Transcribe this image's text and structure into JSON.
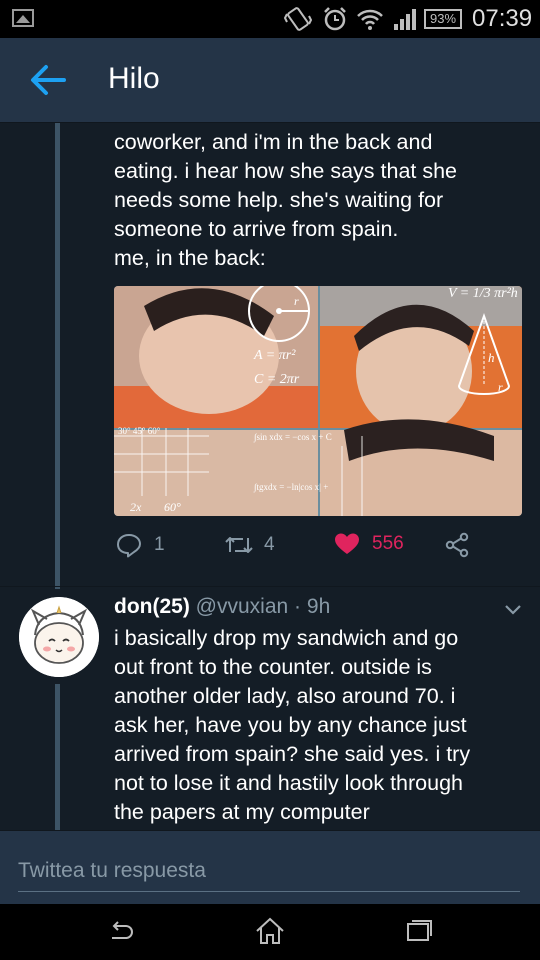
{
  "status_bar": {
    "battery": "93%",
    "time": "07:39"
  },
  "header": {
    "title": "Hilo"
  },
  "tweet1": {
    "text_lines": [
      "coworker, and i'm in the back and",
      "eating. i hear how she says that she",
      "needs some help. she's waiting for",
      "someone to arrive from spain.",
      "me, in the back:"
    ],
    "media": {
      "labels": [
        "r",
        "A = πr²",
        "C = 2πr",
        "V = 1/3 πr²h",
        "h",
        "r",
        "30°  45°  60°",
        "∫sin xdx = −cos x + C",
        "∫tgxdx = −ln|cos x| +",
        "2x",
        "60°"
      ]
    },
    "actions": {
      "replies": "1",
      "retweets": "4",
      "likes": "556"
    }
  },
  "tweet2": {
    "name": "don(25)",
    "handle": "@vvuxian",
    "separator": "·",
    "time": "9h",
    "text_lines": [
      "i basically drop my sandwich and go",
      "out front to the counter. outside is",
      "another older lady, also around 70. i",
      "ask her, have you by any chance just",
      "arrived from spain? she said yes. i try",
      "not to lose it and hastily look through",
      "the papers at my computer"
    ]
  },
  "reply": {
    "placeholder": "Twittea tu respuesta"
  },
  "colors": {
    "background": "#141d26",
    "header": "#243447",
    "accent": "#1da1f2",
    "like": "#e0245e",
    "muted": "#8899a6",
    "thread_line": "#3d5466"
  }
}
